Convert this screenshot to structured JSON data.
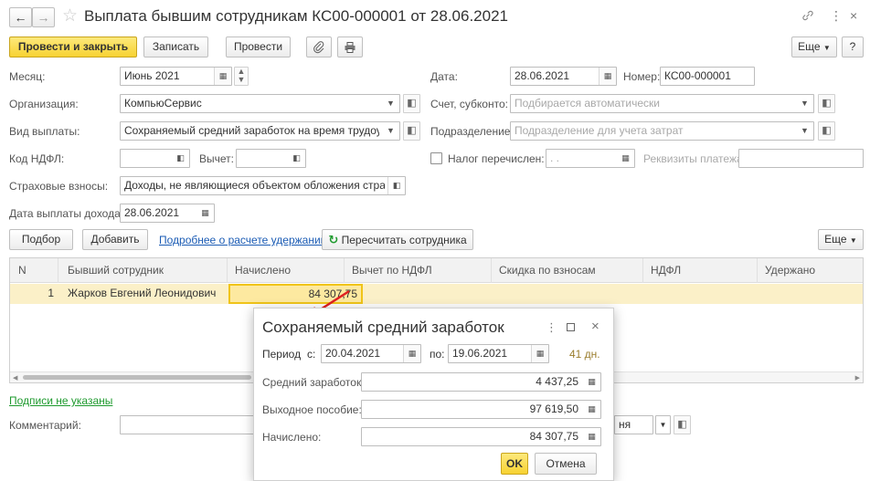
{
  "window": {
    "title": "Выплата бывшим сотрудникам КС00-000001 от 28.06.2021",
    "more_label": "Еще",
    "help_label": "?"
  },
  "toolbar": {
    "post_close_label": "Провести и закрыть",
    "save_label": "Записать",
    "post_label": "Провести",
    "more_label": "Еще"
  },
  "form": {
    "month_label": "Месяц:",
    "month_value": "Июнь 2021",
    "date_label": "Дата:",
    "date_value": "28.06.2021",
    "number_label": "Номер:",
    "number_value": "КС00-000001",
    "org_label": "Организация:",
    "org_value": "КомпьюСервис",
    "account_label": "Счет, субконто:",
    "account_placeholder": "Подбирается автоматически",
    "payment_type_label": "Вид выплаты:",
    "payment_type_value": "Сохраняемый средний заработок на время трудоустройства",
    "department_label": "Подразделение:",
    "department_placeholder": "Подразделение для учета затрат",
    "ndfl_code_label": "Код НДФЛ:",
    "deduction_label": "Вычет:",
    "tax_paid_label": "Налог перечислен:",
    "tax_paid_date_placeholder": " .  .",
    "payment_details_label": "Реквизиты платежа:",
    "insurance_label": "Страховые взносы:",
    "insurance_value": "Доходы, не являющиеся объектом обложения страховыми взносами",
    "income_date_label": "Дата выплаты дохода:",
    "income_date_value": "28.06.2021"
  },
  "table_toolbar": {
    "select_label": "Подбор",
    "add_label": "Добавить",
    "details_link": "Подробнее о расчете удержаний",
    "recalc_label": "Пересчитать сотрудника",
    "more_label": "Еще"
  },
  "table": {
    "columns": [
      "N",
      "Бывший сотрудник",
      "Начислено",
      "Вычет по НДФЛ",
      "Скидка по взносам",
      "НДФЛ",
      "Удержано"
    ],
    "rows": [
      {
        "n": "1",
        "employee": "Жарков Евгений Леонидович",
        "accrued": "84 307,75"
      }
    ]
  },
  "footer": {
    "signatures_link": "Подписи не указаны",
    "comment_label": "Комментарий:",
    "responsible_fragment": "ня"
  },
  "modal": {
    "title": "Сохраняемый средний заработок",
    "period_label": "Период",
    "from_label": "с:",
    "from_value": "20.04.2021",
    "to_label": "по:",
    "to_value": "19.06.2021",
    "days_value": "41 дн.",
    "avg_label": "Средний заработок:",
    "avg_value": "4 437,25",
    "severance_label": "Выходное пособие:",
    "severance_value": "97 619,50",
    "accrued_label": "Начислено:",
    "accrued_value": "84 307,75",
    "ok_label": "OK",
    "cancel_label": "Отмена"
  },
  "colors": {
    "accent_yellow": "#f7d232",
    "selected_row": "#fbf0c8",
    "link_blue": "#1a5bb4",
    "link_green": "#1e9a2e",
    "arrow_red": "#e02020"
  },
  "icons": [
    "back-arrow-icon",
    "forward-arrow-icon",
    "star-icon",
    "link-icon",
    "more-vertical-icon",
    "close-icon",
    "paperclip-icon",
    "print-icon",
    "calendar-icon",
    "spin-icon",
    "dropdown-icon",
    "open-icon",
    "refresh-icon",
    "calculator-icon",
    "maximize-icon"
  ]
}
